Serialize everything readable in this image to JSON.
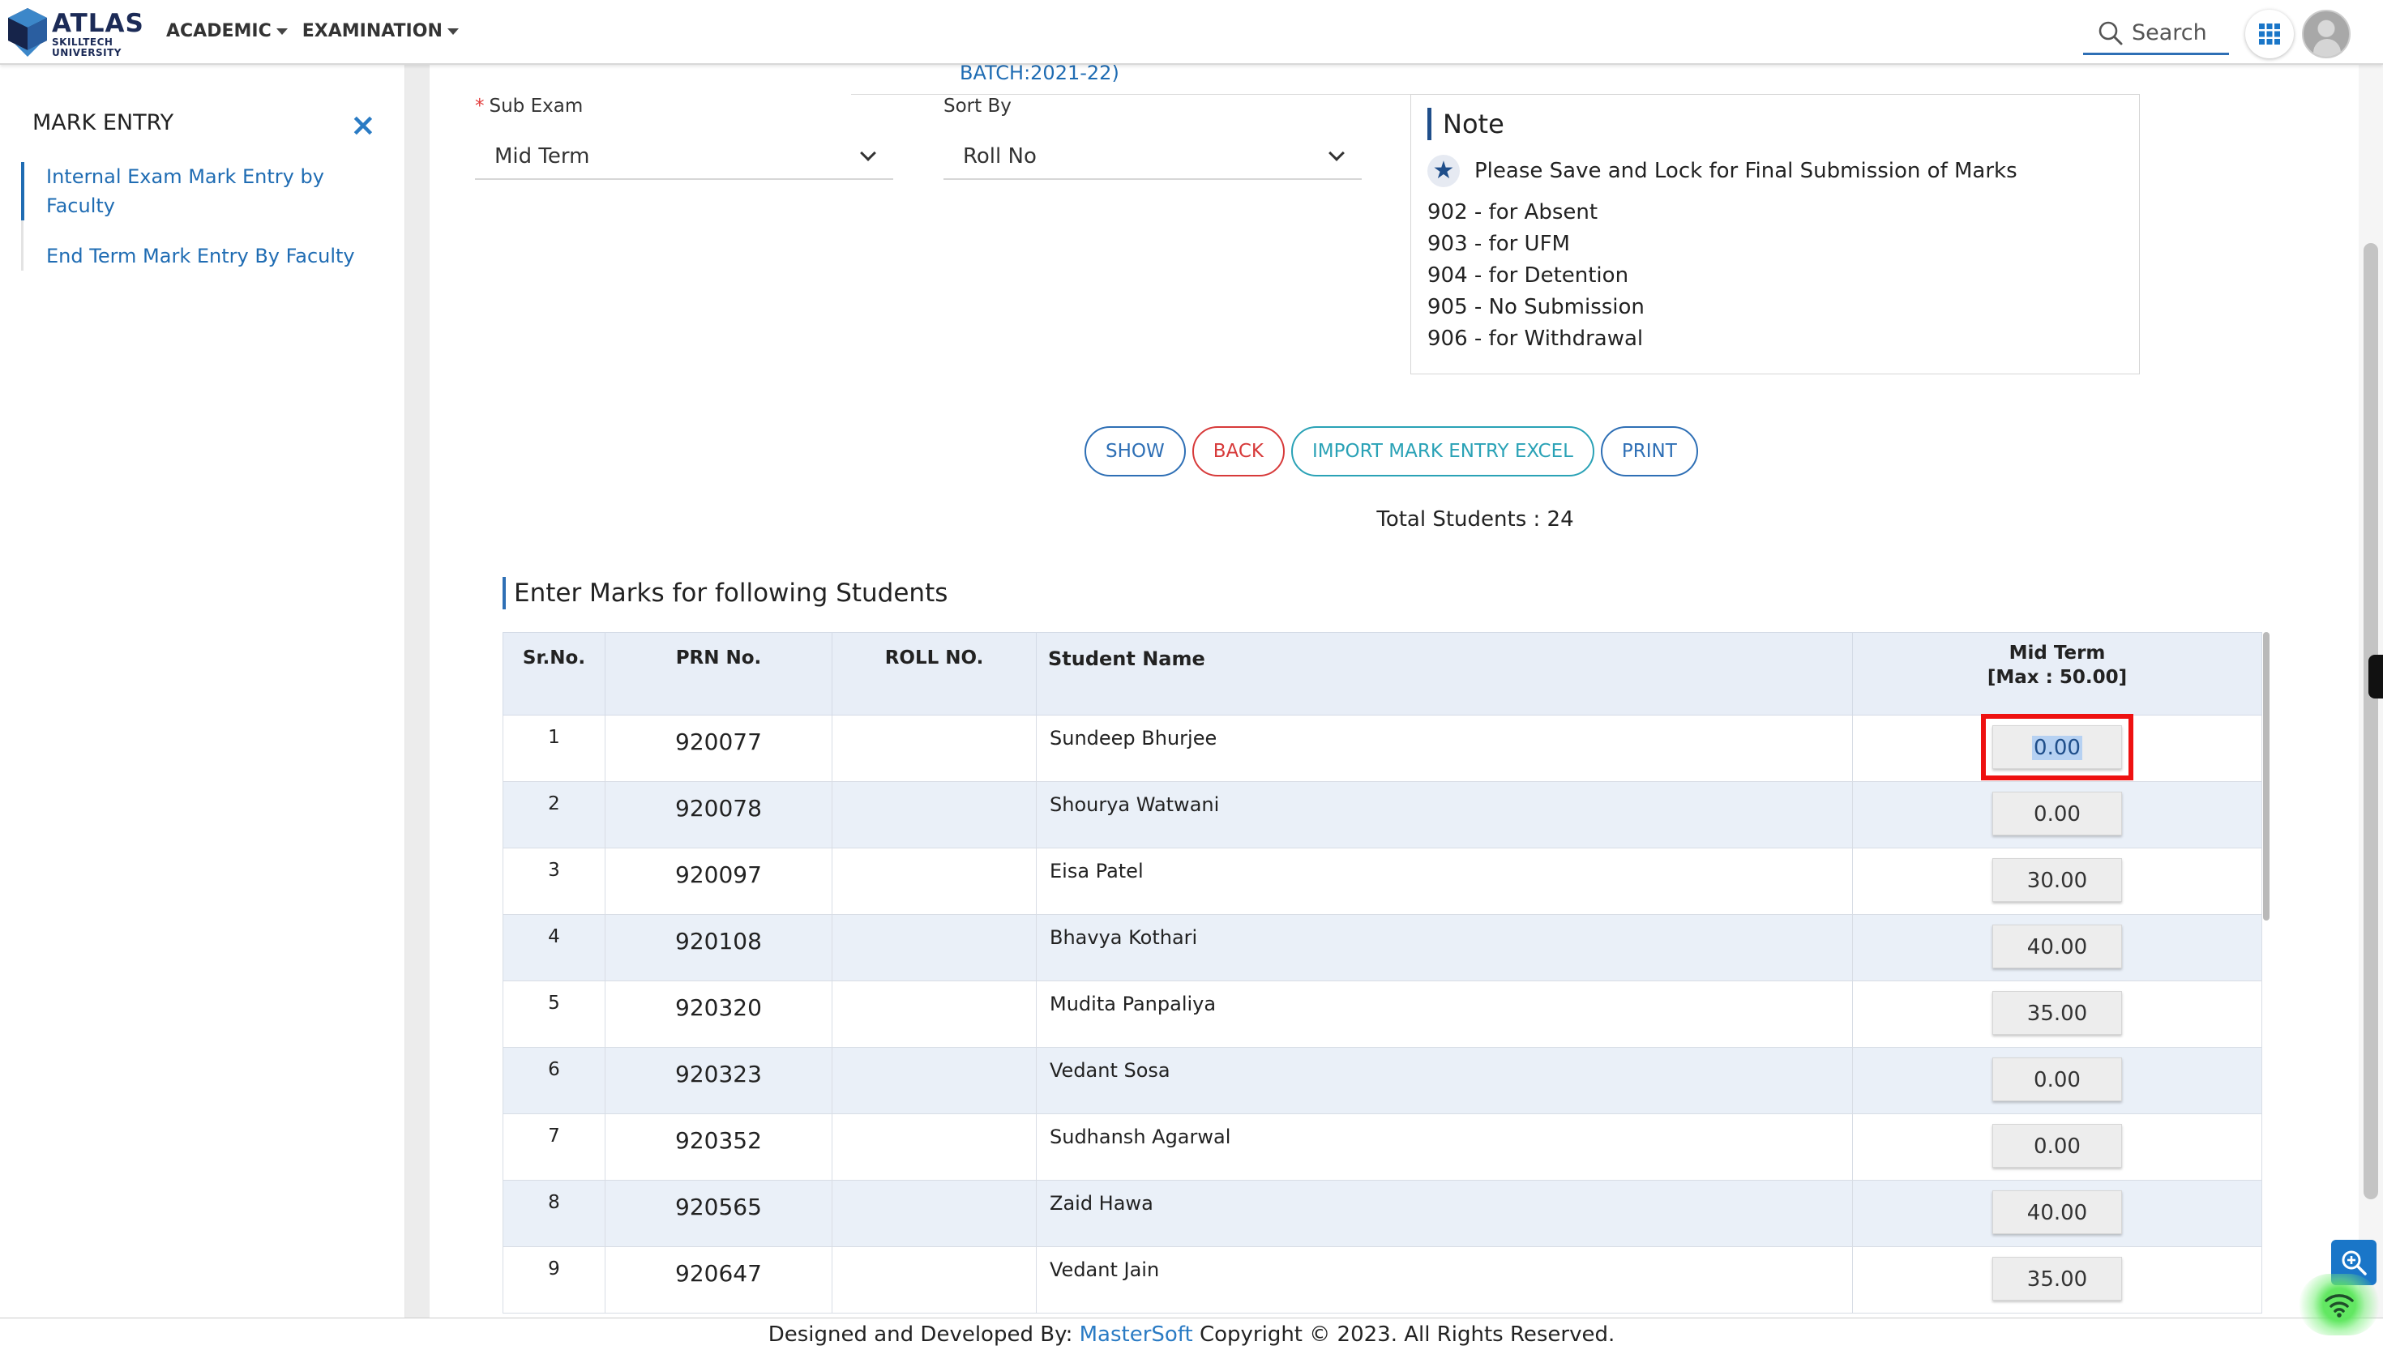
{
  "header": {
    "logo_main": "ATLAS",
    "logo_sub1": "SKILLTECH",
    "logo_sub2": "UNIVERSITY",
    "nav": [
      {
        "label": "ACADEMIC"
      },
      {
        "label": "EXAMINATION"
      }
    ],
    "search_label": "Search"
  },
  "sidebar": {
    "title": "MARK ENTRY",
    "close_icon": "×",
    "items": [
      {
        "label": "Internal Exam Mark Entry by Faculty",
        "active": true
      },
      {
        "label": "End Term Mark Entry By Faculty",
        "active": false
      }
    ]
  },
  "form": {
    "batch_text": "BATCH:2021-22)",
    "sub_exam": {
      "required_mark": "*",
      "label": "Sub Exam",
      "value": "Mid Term"
    },
    "sort_by": {
      "label": "Sort By",
      "value": "Roll No"
    }
  },
  "note": {
    "title": "Note",
    "star_line": "Please Save and Lock for Final Submission of Marks",
    "codes": [
      "902 - for Absent",
      "903 - for UFM",
      "904 - for Detention",
      "905 - No Submission",
      "906 - for Withdrawal"
    ]
  },
  "actions": {
    "show": "SHOW",
    "back": "BACK",
    "import": "IMPORT MARK ENTRY EXCEL",
    "print": "PRINT"
  },
  "summary": {
    "total_students": "Total Students : 24"
  },
  "table": {
    "title": "Enter Marks for following Students",
    "headers": {
      "sr": "Sr.No.",
      "prn": "PRN No.",
      "roll": "ROLL NO.",
      "name": "Student Name",
      "mark": "Mid Term",
      "mark_max": "[Max : 50.00]"
    },
    "rows": [
      {
        "sr": "1",
        "prn": "920077",
        "roll": "",
        "name": "Sundeep Bhurjee",
        "mark": "0.00"
      },
      {
        "sr": "2",
        "prn": "920078",
        "roll": "",
        "name": "Shourya Watwani",
        "mark": "0.00"
      },
      {
        "sr": "3",
        "prn": "920097",
        "roll": "",
        "name": "Eisa Patel",
        "mark": "30.00"
      },
      {
        "sr": "4",
        "prn": "920108",
        "roll": "",
        "name": "Bhavya Kothari",
        "mark": "40.00"
      },
      {
        "sr": "5",
        "prn": "920320",
        "roll": "",
        "name": "Mudita Panpaliya",
        "mark": "35.00"
      },
      {
        "sr": "6",
        "prn": "920323",
        "roll": "",
        "name": "Vedant Sosa",
        "mark": "0.00"
      },
      {
        "sr": "7",
        "prn": "920352",
        "roll": "",
        "name": "Sudhansh Agarwal",
        "mark": "0.00"
      },
      {
        "sr": "8",
        "prn": "920565",
        "roll": "",
        "name": "Zaid Hawa",
        "mark": "40.00"
      },
      {
        "sr": "9",
        "prn": "920647",
        "roll": "",
        "name": "Vedant Jain",
        "mark": "35.00"
      }
    ]
  },
  "footer": {
    "prefix": "Designed and Developed By: ",
    "brand": "MasterSoft",
    "suffix": " Copyright © 2023. All Rights Reserved."
  },
  "icons": {
    "logo": "atlas-cube-logo-icon",
    "search": "search-icon",
    "apps": "apps-grid-icon",
    "avatar": "user-avatar-icon",
    "star": "star-icon",
    "close": "close-icon",
    "zoom": "zoom-search-icon",
    "wifi": "wifi-icon"
  },
  "colors": {
    "accent_blue": "#2e6fb5",
    "link_blue": "#1f6cb3",
    "back_red": "#d73a3a",
    "import_teal": "#2aa2b6",
    "table_header_bg": "#e8eef7",
    "table_alt_row_bg": "#eaf0f8",
    "highlight_red": "#ee1111"
  }
}
